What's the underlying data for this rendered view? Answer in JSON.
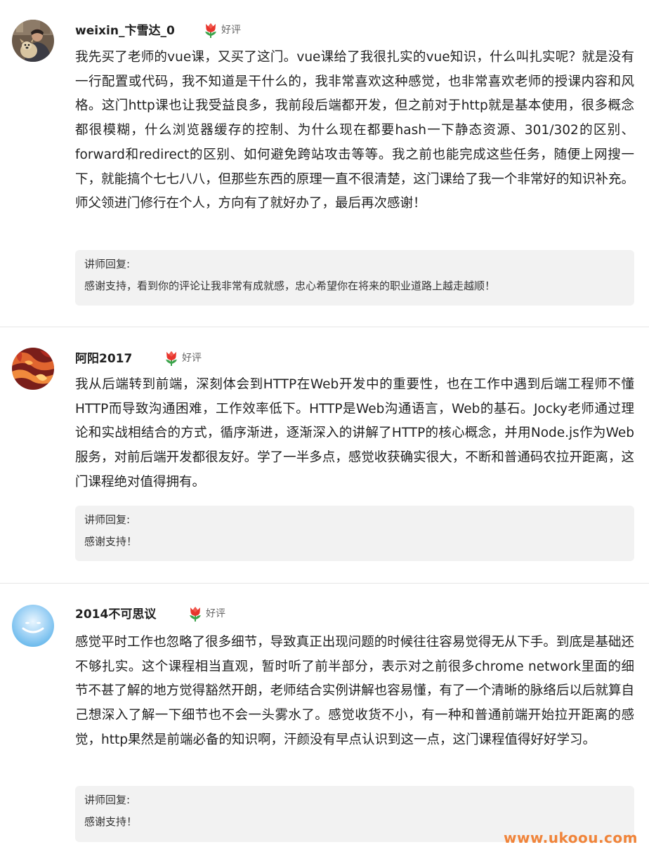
{
  "reviews": [
    {
      "username": "weixin_卞雪达_0",
      "rating_label": "好评",
      "content": "我先买了老师的vue课，又买了这门。vue课给了我很扎实的vue知识，什么叫扎实呢？就是没有一行配置或代码，我不知道是干什么的，我非常喜欢这种感觉，也非常喜欢老师的授课内容和风格。这门http课也让我受益良多，我前段后端都开发，但之前对于http就是基本使用，很多概念都很模糊，什么浏览器缓存的控制、为什么现在都要hash一下静态资源、301/302的区别、forward和redirect的区别、如何避免跨站攻击等等。我之前也能完成这些任务，随便上网搜一下，就能搞个七七八八，但那些东西的原理一直不很清楚，这门课给了我一个非常好的知识补充。师父领进门修行在个人，方向有了就好办了，最后再次感谢！",
      "reply_title": "讲师回复:",
      "reply_text": "感谢支持，看到你的评论让我非常有成就感，忠心希望你在将来的职业道路上越走越顺！"
    },
    {
      "username": "阿阳2017",
      "rating_label": "好评",
      "content": "我从后端转到前端，深刻体会到HTTP在Web开发中的重要性，也在工作中遇到后端工程师不懂HTTP而导致沟通困难，工作效率低下。HTTP是Web沟通语言，Web的基石。Jocky老师通过理论和实战相结合的方式，循序渐进，逐渐深入的讲解了HTTP的核心概念，并用Node.js作为Web服务，对前后端开发都很友好。学了一半多点，感觉收获确实很大，不断和普通码农拉开距离，这门课程绝对值得拥有。",
      "reply_title": "讲师回复:",
      "reply_text": "感谢支持！"
    },
    {
      "username": "2014不可思议",
      "rating_label": "好评",
      "content": "感觉平时工作也忽略了很多细节，导致真正出现问题的时候往往容易觉得无从下手。到底是基础还不够扎实。这个课程相当直观，暂时听了前半部分，表示对之前很多chrome network里面的细节不甚了解的地方觉得豁然开朗，老师结合实例讲解也容易懂，有了一个清晰的脉络后以后就算自己想深入了解一下细节也不会一头雾水了。感觉收货不小，有一种和普通前端开始拉开距离的感觉，http果然是前端必备的知识啊，汗颜没有早点认识到这一点，这门课程值得好好学习。",
      "reply_title": "讲师回复:",
      "reply_text": "感谢支持！"
    }
  ],
  "icons": {
    "rating": "tulip-icon",
    "avatar_1": "person-with-dog-photo",
    "avatar_2": "red-orange-abstract-photo",
    "avatar_3": "blue-sky-smile-photo"
  },
  "colors": {
    "background": "#ffffff",
    "reply_background": "#f2f2f2",
    "divider": "#e6e6e6",
    "tulip_red": "#e8352d",
    "tulip_green": "#3aa34a",
    "watermark": "#f0843a"
  },
  "watermark": "www.ukoou.com"
}
